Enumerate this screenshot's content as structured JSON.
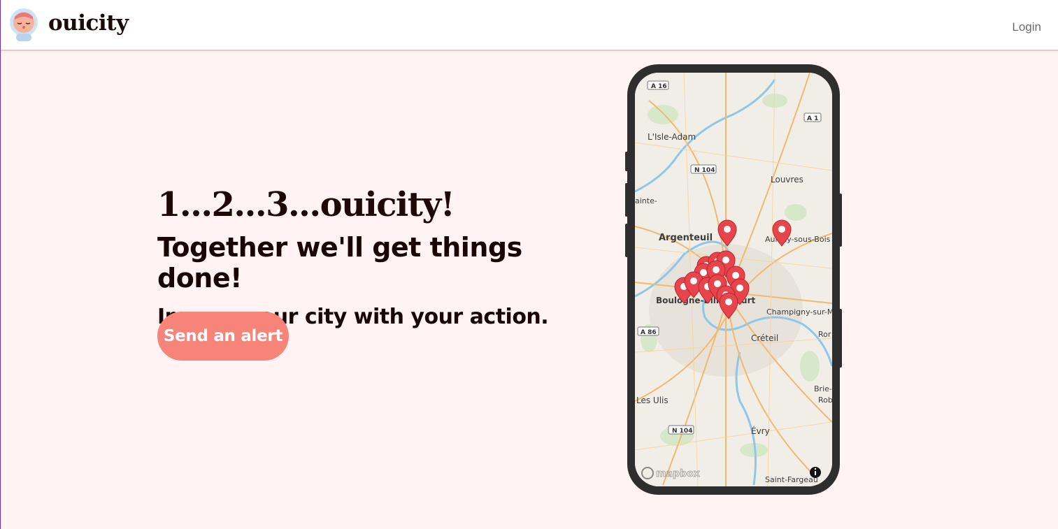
{
  "header": {
    "brand": "ouicity",
    "login_label": "Login"
  },
  "hero": {
    "title": "1...2...3...ouicity!",
    "subtitle": "Together we'll get things done!",
    "tagline": "Improve our city with your action.",
    "cta_label": "Send an alert"
  },
  "map": {
    "attribution": "mapbox",
    "place_labels": [
      "L'Isle-Adam",
      "Louvres",
      "Argenteuil",
      "Aulnay-sous-Bois",
      "Boulogne-Billancourt",
      "Champigny-sur-Marne",
      "Créteil",
      "Les Ulis",
      "Évry",
      "Saint-Fargeau",
      "Brie-C",
      "Rob",
      "Ror",
      "ainte-"
    ],
    "road_labels": [
      "A 16",
      "A 1",
      "N 104",
      "A 86",
      "N 104"
    ]
  },
  "colors": {
    "accent": "#f78479",
    "background": "#fff4f3",
    "marker": "#e8444c",
    "header_border": "#f6c4c4"
  }
}
